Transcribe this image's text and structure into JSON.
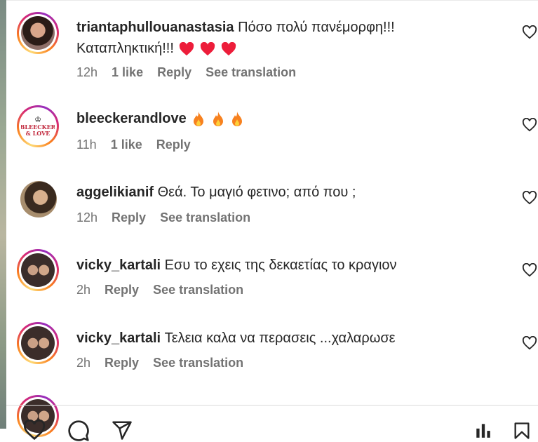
{
  "comments": [
    {
      "username": "triantaphullouanastasia",
      "text": "Πόσο πολύ πανέμορφη!!!",
      "text_line2": "Καταπληκτική!!!",
      "emoji": "red-heart",
      "emoji_count": 3,
      "time": "12h",
      "likes": "1 like",
      "reply": "Reply",
      "translation": "See translation"
    },
    {
      "username": "bleeckerandlove",
      "text": "",
      "emoji": "fire",
      "emoji_count": 3,
      "time": "11h",
      "likes": "1 like",
      "reply": "Reply",
      "avatar_logo_text": "BLEECKER & LOVE"
    },
    {
      "username": "aggelikianif",
      "text": "Θεά. Το μαγιό φετινο; από που ;",
      "time": "12h",
      "reply": "Reply",
      "translation": "See translation"
    },
    {
      "username": "vicky_kartali",
      "text": "Εσυ το εχεις της δεκαετίας το κραγιον",
      "time": "2h",
      "reply": "Reply",
      "translation": "See translation"
    },
    {
      "username": "vicky_kartali",
      "text": "Τελεια καλα να περασεις ...χαλαρωσε",
      "time": "2h",
      "reply": "Reply",
      "translation": "See translation"
    }
  ],
  "icons": {
    "comment_like": "heart-outline-icon",
    "action_bar": [
      "heart-icon",
      "comment-icon",
      "share-icon",
      "stats-icon",
      "save-icon"
    ]
  },
  "colors": {
    "text": "#262626",
    "muted": "#737373",
    "heart": "#ed1d3a",
    "flame": "#f7811f"
  }
}
